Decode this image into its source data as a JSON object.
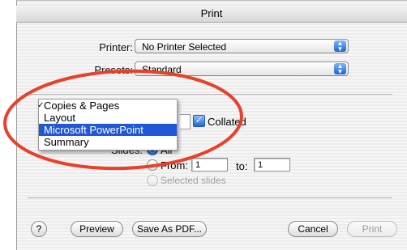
{
  "window": {
    "title": "Print"
  },
  "printer": {
    "label": "Printer:",
    "value": "No Printer Selected"
  },
  "presets": {
    "label": "Presets:",
    "value": "Standard"
  },
  "panel_menu": {
    "items": [
      {
        "label": "Copies & Pages",
        "checked": true,
        "selected": false
      },
      {
        "label": "Layout",
        "checked": false,
        "selected": false
      },
      {
        "label": "Microsoft PowerPoint",
        "checked": false,
        "selected": true
      },
      {
        "label": "Summary",
        "checked": false,
        "selected": false
      }
    ],
    "check_glyph": "✓"
  },
  "collated": {
    "label": "Collated",
    "checked": true
  },
  "slides": {
    "label": "Slides:",
    "all_label": "All",
    "from_label": "From:",
    "from_value": "1",
    "to_label": "to:",
    "to_value": "1",
    "selected_label": "Selected slides"
  },
  "buttons": {
    "help": "?",
    "preview": "Preview",
    "save_pdf": "Save As PDF...",
    "cancel": "Cancel",
    "print": "Print"
  },
  "colors": {
    "annotation": "#e8402a",
    "menu_highlight": "#1f57d6",
    "popup_arrow": "#1a63d8"
  }
}
